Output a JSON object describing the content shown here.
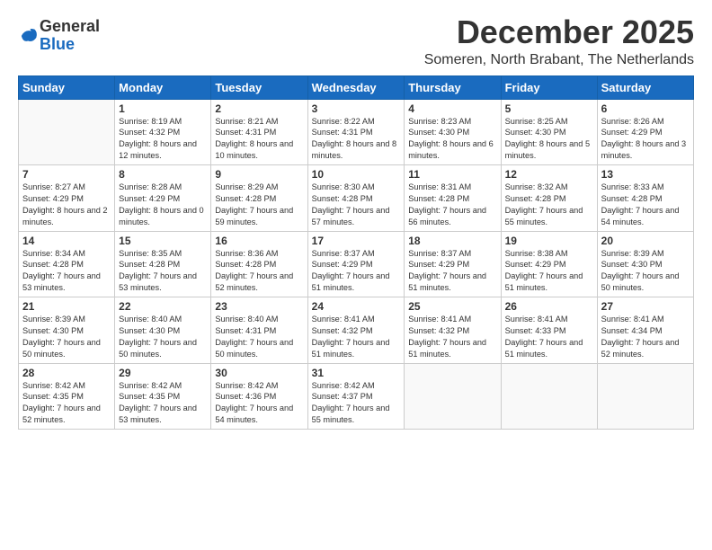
{
  "logo": {
    "general": "General",
    "blue": "Blue"
  },
  "header": {
    "month": "December 2025",
    "location": "Someren, North Brabant, The Netherlands"
  },
  "weekdays": [
    "Sunday",
    "Monday",
    "Tuesday",
    "Wednesday",
    "Thursday",
    "Friday",
    "Saturday"
  ],
  "weeks": [
    [
      {
        "day": "",
        "sunrise": "",
        "sunset": "",
        "daylight": ""
      },
      {
        "day": "1",
        "sunrise": "Sunrise: 8:19 AM",
        "sunset": "Sunset: 4:32 PM",
        "daylight": "Daylight: 8 hours and 12 minutes."
      },
      {
        "day": "2",
        "sunrise": "Sunrise: 8:21 AM",
        "sunset": "Sunset: 4:31 PM",
        "daylight": "Daylight: 8 hours and 10 minutes."
      },
      {
        "day": "3",
        "sunrise": "Sunrise: 8:22 AM",
        "sunset": "Sunset: 4:31 PM",
        "daylight": "Daylight: 8 hours and 8 minutes."
      },
      {
        "day": "4",
        "sunrise": "Sunrise: 8:23 AM",
        "sunset": "Sunset: 4:30 PM",
        "daylight": "Daylight: 8 hours and 6 minutes."
      },
      {
        "day": "5",
        "sunrise": "Sunrise: 8:25 AM",
        "sunset": "Sunset: 4:30 PM",
        "daylight": "Daylight: 8 hours and 5 minutes."
      },
      {
        "day": "6",
        "sunrise": "Sunrise: 8:26 AM",
        "sunset": "Sunset: 4:29 PM",
        "daylight": "Daylight: 8 hours and 3 minutes."
      }
    ],
    [
      {
        "day": "7",
        "sunrise": "Sunrise: 8:27 AM",
        "sunset": "Sunset: 4:29 PM",
        "daylight": "Daylight: 8 hours and 2 minutes."
      },
      {
        "day": "8",
        "sunrise": "Sunrise: 8:28 AM",
        "sunset": "Sunset: 4:29 PM",
        "daylight": "Daylight: 8 hours and 0 minutes."
      },
      {
        "day": "9",
        "sunrise": "Sunrise: 8:29 AM",
        "sunset": "Sunset: 4:28 PM",
        "daylight": "Daylight: 7 hours and 59 minutes."
      },
      {
        "day": "10",
        "sunrise": "Sunrise: 8:30 AM",
        "sunset": "Sunset: 4:28 PM",
        "daylight": "Daylight: 7 hours and 57 minutes."
      },
      {
        "day": "11",
        "sunrise": "Sunrise: 8:31 AM",
        "sunset": "Sunset: 4:28 PM",
        "daylight": "Daylight: 7 hours and 56 minutes."
      },
      {
        "day": "12",
        "sunrise": "Sunrise: 8:32 AM",
        "sunset": "Sunset: 4:28 PM",
        "daylight": "Daylight: 7 hours and 55 minutes."
      },
      {
        "day": "13",
        "sunrise": "Sunrise: 8:33 AM",
        "sunset": "Sunset: 4:28 PM",
        "daylight": "Daylight: 7 hours and 54 minutes."
      }
    ],
    [
      {
        "day": "14",
        "sunrise": "Sunrise: 8:34 AM",
        "sunset": "Sunset: 4:28 PM",
        "daylight": "Daylight: 7 hours and 53 minutes."
      },
      {
        "day": "15",
        "sunrise": "Sunrise: 8:35 AM",
        "sunset": "Sunset: 4:28 PM",
        "daylight": "Daylight: 7 hours and 53 minutes."
      },
      {
        "day": "16",
        "sunrise": "Sunrise: 8:36 AM",
        "sunset": "Sunset: 4:28 PM",
        "daylight": "Daylight: 7 hours and 52 minutes."
      },
      {
        "day": "17",
        "sunrise": "Sunrise: 8:37 AM",
        "sunset": "Sunset: 4:29 PM",
        "daylight": "Daylight: 7 hours and 51 minutes."
      },
      {
        "day": "18",
        "sunrise": "Sunrise: 8:37 AM",
        "sunset": "Sunset: 4:29 PM",
        "daylight": "Daylight: 7 hours and 51 minutes."
      },
      {
        "day": "19",
        "sunrise": "Sunrise: 8:38 AM",
        "sunset": "Sunset: 4:29 PM",
        "daylight": "Daylight: 7 hours and 51 minutes."
      },
      {
        "day": "20",
        "sunrise": "Sunrise: 8:39 AM",
        "sunset": "Sunset: 4:30 PM",
        "daylight": "Daylight: 7 hours and 50 minutes."
      }
    ],
    [
      {
        "day": "21",
        "sunrise": "Sunrise: 8:39 AM",
        "sunset": "Sunset: 4:30 PM",
        "daylight": "Daylight: 7 hours and 50 minutes."
      },
      {
        "day": "22",
        "sunrise": "Sunrise: 8:40 AM",
        "sunset": "Sunset: 4:30 PM",
        "daylight": "Daylight: 7 hours and 50 minutes."
      },
      {
        "day": "23",
        "sunrise": "Sunrise: 8:40 AM",
        "sunset": "Sunset: 4:31 PM",
        "daylight": "Daylight: 7 hours and 50 minutes."
      },
      {
        "day": "24",
        "sunrise": "Sunrise: 8:41 AM",
        "sunset": "Sunset: 4:32 PM",
        "daylight": "Daylight: 7 hours and 51 minutes."
      },
      {
        "day": "25",
        "sunrise": "Sunrise: 8:41 AM",
        "sunset": "Sunset: 4:32 PM",
        "daylight": "Daylight: 7 hours and 51 minutes."
      },
      {
        "day": "26",
        "sunrise": "Sunrise: 8:41 AM",
        "sunset": "Sunset: 4:33 PM",
        "daylight": "Daylight: 7 hours and 51 minutes."
      },
      {
        "day": "27",
        "sunrise": "Sunrise: 8:41 AM",
        "sunset": "Sunset: 4:34 PM",
        "daylight": "Daylight: 7 hours and 52 minutes."
      }
    ],
    [
      {
        "day": "28",
        "sunrise": "Sunrise: 8:42 AM",
        "sunset": "Sunset: 4:35 PM",
        "daylight": "Daylight: 7 hours and 52 minutes."
      },
      {
        "day": "29",
        "sunrise": "Sunrise: 8:42 AM",
        "sunset": "Sunset: 4:35 PM",
        "daylight": "Daylight: 7 hours and 53 minutes."
      },
      {
        "day": "30",
        "sunrise": "Sunrise: 8:42 AM",
        "sunset": "Sunset: 4:36 PM",
        "daylight": "Daylight: 7 hours and 54 minutes."
      },
      {
        "day": "31",
        "sunrise": "Sunrise: 8:42 AM",
        "sunset": "Sunset: 4:37 PM",
        "daylight": "Daylight: 7 hours and 55 minutes."
      },
      {
        "day": "",
        "sunrise": "",
        "sunset": "",
        "daylight": ""
      },
      {
        "day": "",
        "sunrise": "",
        "sunset": "",
        "daylight": ""
      },
      {
        "day": "",
        "sunrise": "",
        "sunset": "",
        "daylight": ""
      }
    ]
  ]
}
